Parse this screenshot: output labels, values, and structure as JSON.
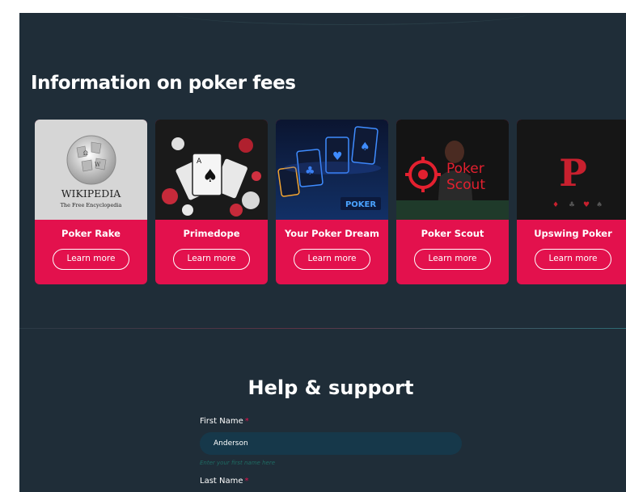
{
  "fees_section": {
    "title": "Information on poker fees",
    "cards": [
      {
        "name": "Poker Rake",
        "button": "Learn more",
        "image_caption_1": "WIKIPEDIA",
        "image_caption_2": "The Free Encyclopedia"
      },
      {
        "name": "Primedope",
        "button": "Learn more"
      },
      {
        "name": "Your Poker Dream",
        "button": "Learn more",
        "image_text": "POKER"
      },
      {
        "name": "Poker Scout",
        "button": "Learn more",
        "image_text_1": "Poker",
        "image_text_2": "Scout"
      },
      {
        "name": "Upswing Poker",
        "button": "Learn more",
        "image_text": "P"
      }
    ]
  },
  "support": {
    "title": "Help & support",
    "first_name_label": "First Name",
    "first_name_value": "Anderson",
    "first_name_hint": "Enter your first name here",
    "last_name_label": "Last Name",
    "required_mark": "*"
  },
  "colors": {
    "background": "#1f2d38",
    "accent": "#e3114d",
    "input_bg": "#16384a"
  }
}
